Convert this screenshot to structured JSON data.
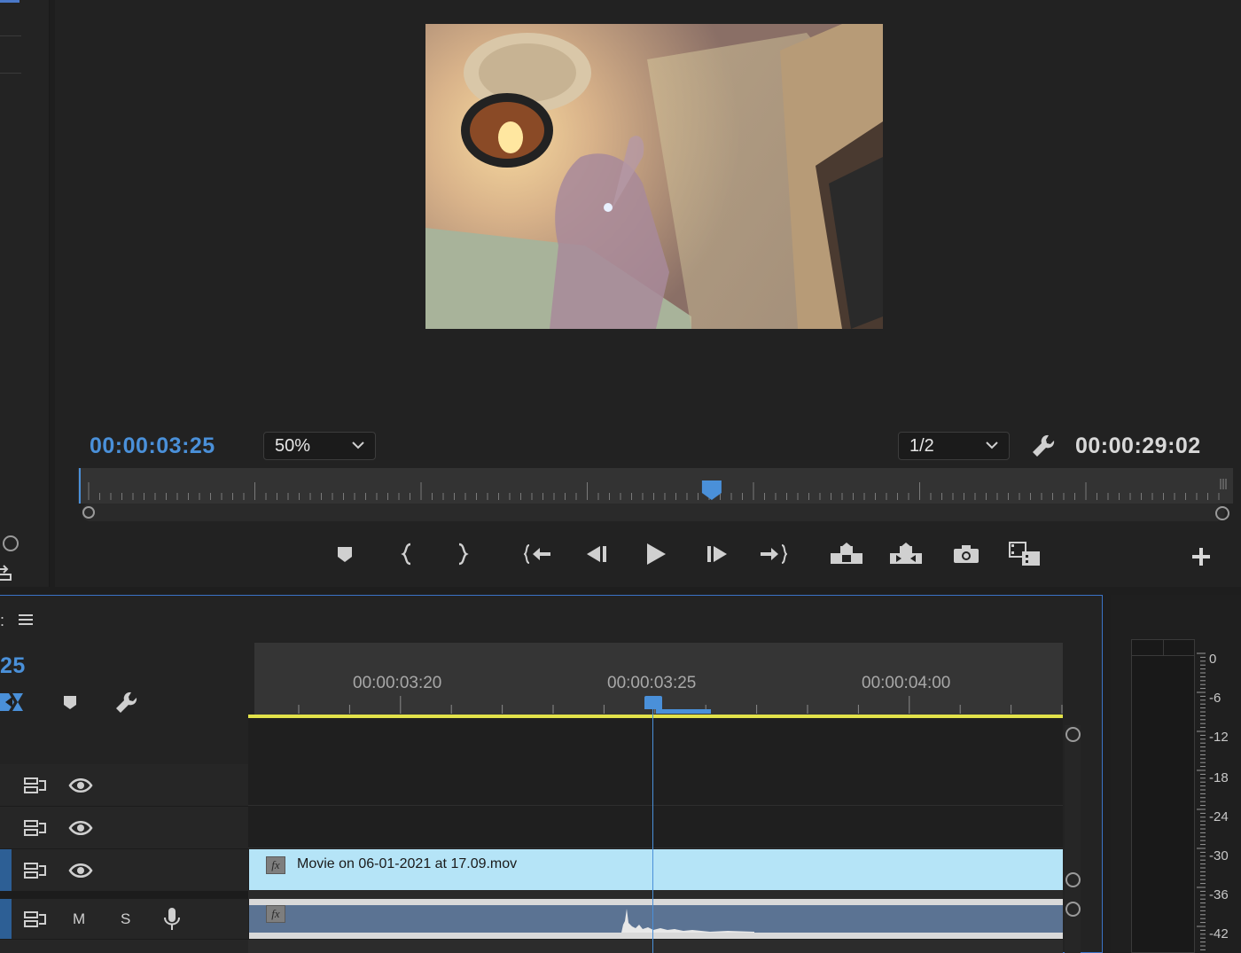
{
  "monitor": {
    "current_timecode": "00:00:03:25",
    "zoom": "50%",
    "resolution": "1/2",
    "duration_timecode": "00:00:29:02",
    "playhead_fraction": 0.55
  },
  "timeline": {
    "partial_timecode": "25",
    "ruler_labels": [
      "00:00:03:20",
      "00:00:03:25",
      "00:00:04:00"
    ],
    "tracks": {
      "audio_mute": "M",
      "audio_solo": "S"
    },
    "video_clip": {
      "name": "Movie on 06-01-2021 at 17.09.mov",
      "fx": "fx"
    },
    "audio_clip": {
      "fx": "fx"
    }
  },
  "audio_meter": {
    "db_labels": [
      "0",
      "-6",
      "-12",
      "-18",
      "-24",
      "-30",
      "-36",
      "-42"
    ]
  },
  "colors": {
    "accent_blue": "#4a90d9",
    "video_clip": "#b5e4f7",
    "audio_clip": "#5b7393",
    "work_area": "#e2e24a"
  }
}
